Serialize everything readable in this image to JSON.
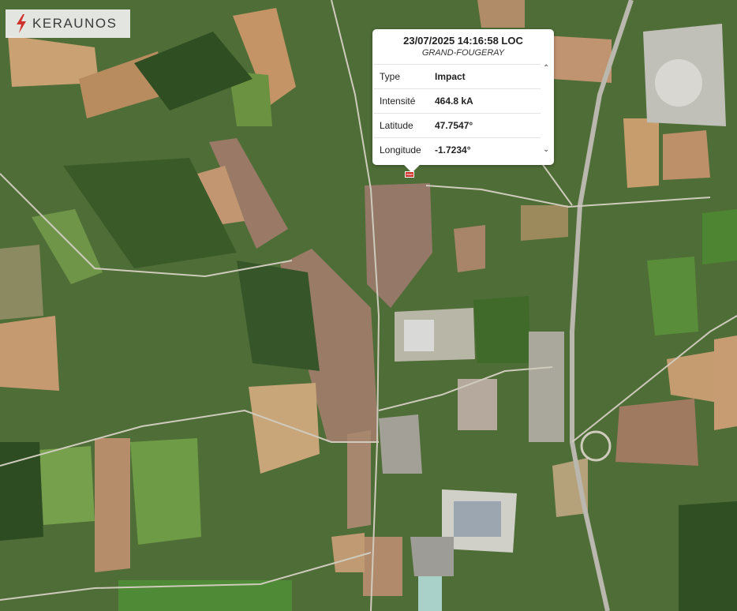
{
  "brand": {
    "name": "KERAUNOS",
    "accent": "#d0312d",
    "logo_icon": "lightning-bolt-icon"
  },
  "popup": {
    "title": "23/07/2025 14:16:58 LOC",
    "subtitle": "GRAND-FOUGERAY",
    "rows": [
      {
        "label": "Type",
        "value": "Impact"
      },
      {
        "label": "Intensité",
        "value": "464.8 kA"
      },
      {
        "label": "Latitude",
        "value": "47.7547°"
      },
      {
        "label": "Longitude",
        "value": "-1.7234°"
      }
    ],
    "scroll_up_icon": "chevron-up-icon",
    "scroll_down_icon": "chevron-down-icon"
  },
  "marker": {
    "icon": "lightning-impact-marker-icon",
    "color": "#d0312d"
  }
}
